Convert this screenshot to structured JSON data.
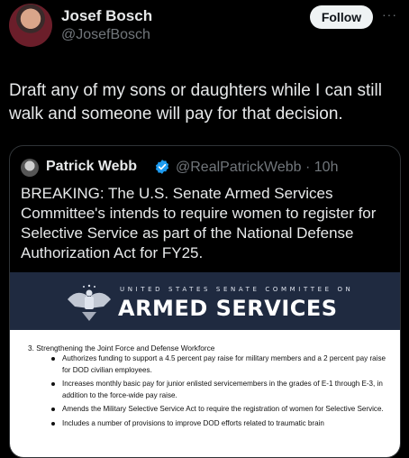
{
  "author": {
    "name": "Josef Bosch",
    "handle": "@JosefBosch"
  },
  "follow_label": "Follow",
  "more_label": "···",
  "tweet_text": "Draft any of my sons or daughters while I can still walk and someone will pay for that decision.",
  "quoted": {
    "name": "Patrick Webb",
    "handle_time": "@RealPatrickWebb · 10h",
    "text": "BREAKING: The U.S. Senate Armed Services Committee's intends to require women to register for Selective Service as part of the National Defense Authorization Act for FY25.",
    "banner": {
      "subtitle": "UNITED STATES SENATE COMMITTEE ON",
      "title": "ARMED SERVICES"
    },
    "document": {
      "heading": "3.   Strengthening the Joint Force and Defense Workforce",
      "bullets": [
        "Authorizes funding to support a 4.5 percent pay raise for military members and a 2 percent pay raise for DOD civilian employees.",
        "Increases monthly basic pay for junior enlisted servicemembers in the grades of E-1 through E-3, in addition to the force-wide pay raise.",
        "Amends the Military Selective Service Act to require the registration of women for Selective Service.",
        "Includes a number of provisions to improve DOD efforts related to traumatic brain"
      ]
    }
  },
  "colors": {
    "background": "#000000",
    "text": "#e7e9ea",
    "secondary_text": "#71767b",
    "verified_blue": "#1d9bf0",
    "banner_navy": "#1f2a40"
  }
}
